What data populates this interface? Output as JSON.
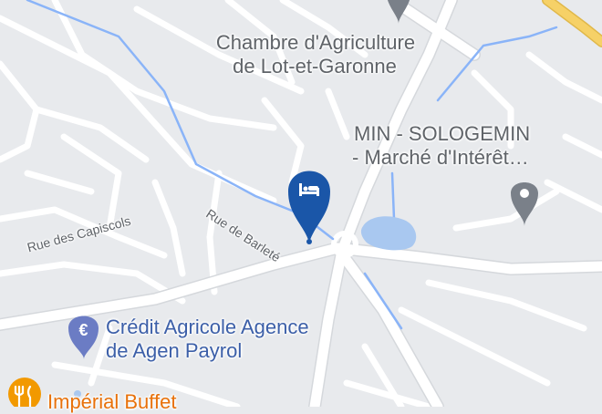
{
  "colors": {
    "background": "#e8eaed",
    "road": "#ffffff",
    "road_outline": "#d5d8dc",
    "water": "#a9c8f0",
    "waterway": "#8ab4f8",
    "highway": "#f6d167",
    "hotel_pin": "#1a56a8",
    "poi_gray": "#7a8089",
    "bank_pin": "#6b7cc4",
    "food_pin": "#f29900"
  },
  "pois": {
    "chambre_agriculture": {
      "line1": "Chambre d'Agriculture",
      "line2": "de Lot-et-Garonne",
      "icon": "map-pin"
    },
    "min_sologemin": {
      "line1": "MIN - SOLOGEMIN",
      "line2": "- Marché d'Intérêt…",
      "icon": "map-pin"
    },
    "credit_agricole": {
      "line1": "Crédit Agricole Agence",
      "line2": "de Agen Payrol",
      "icon": "euro-symbol"
    },
    "imperial_buffet": {
      "line1": "Impérial Buffet",
      "icon": "fork-knife"
    }
  },
  "hotel_marker": {
    "icon": "bed"
  },
  "streets": {
    "barlete": "Rue de Barleté",
    "capiscols": "Rue des Capiscols"
  }
}
